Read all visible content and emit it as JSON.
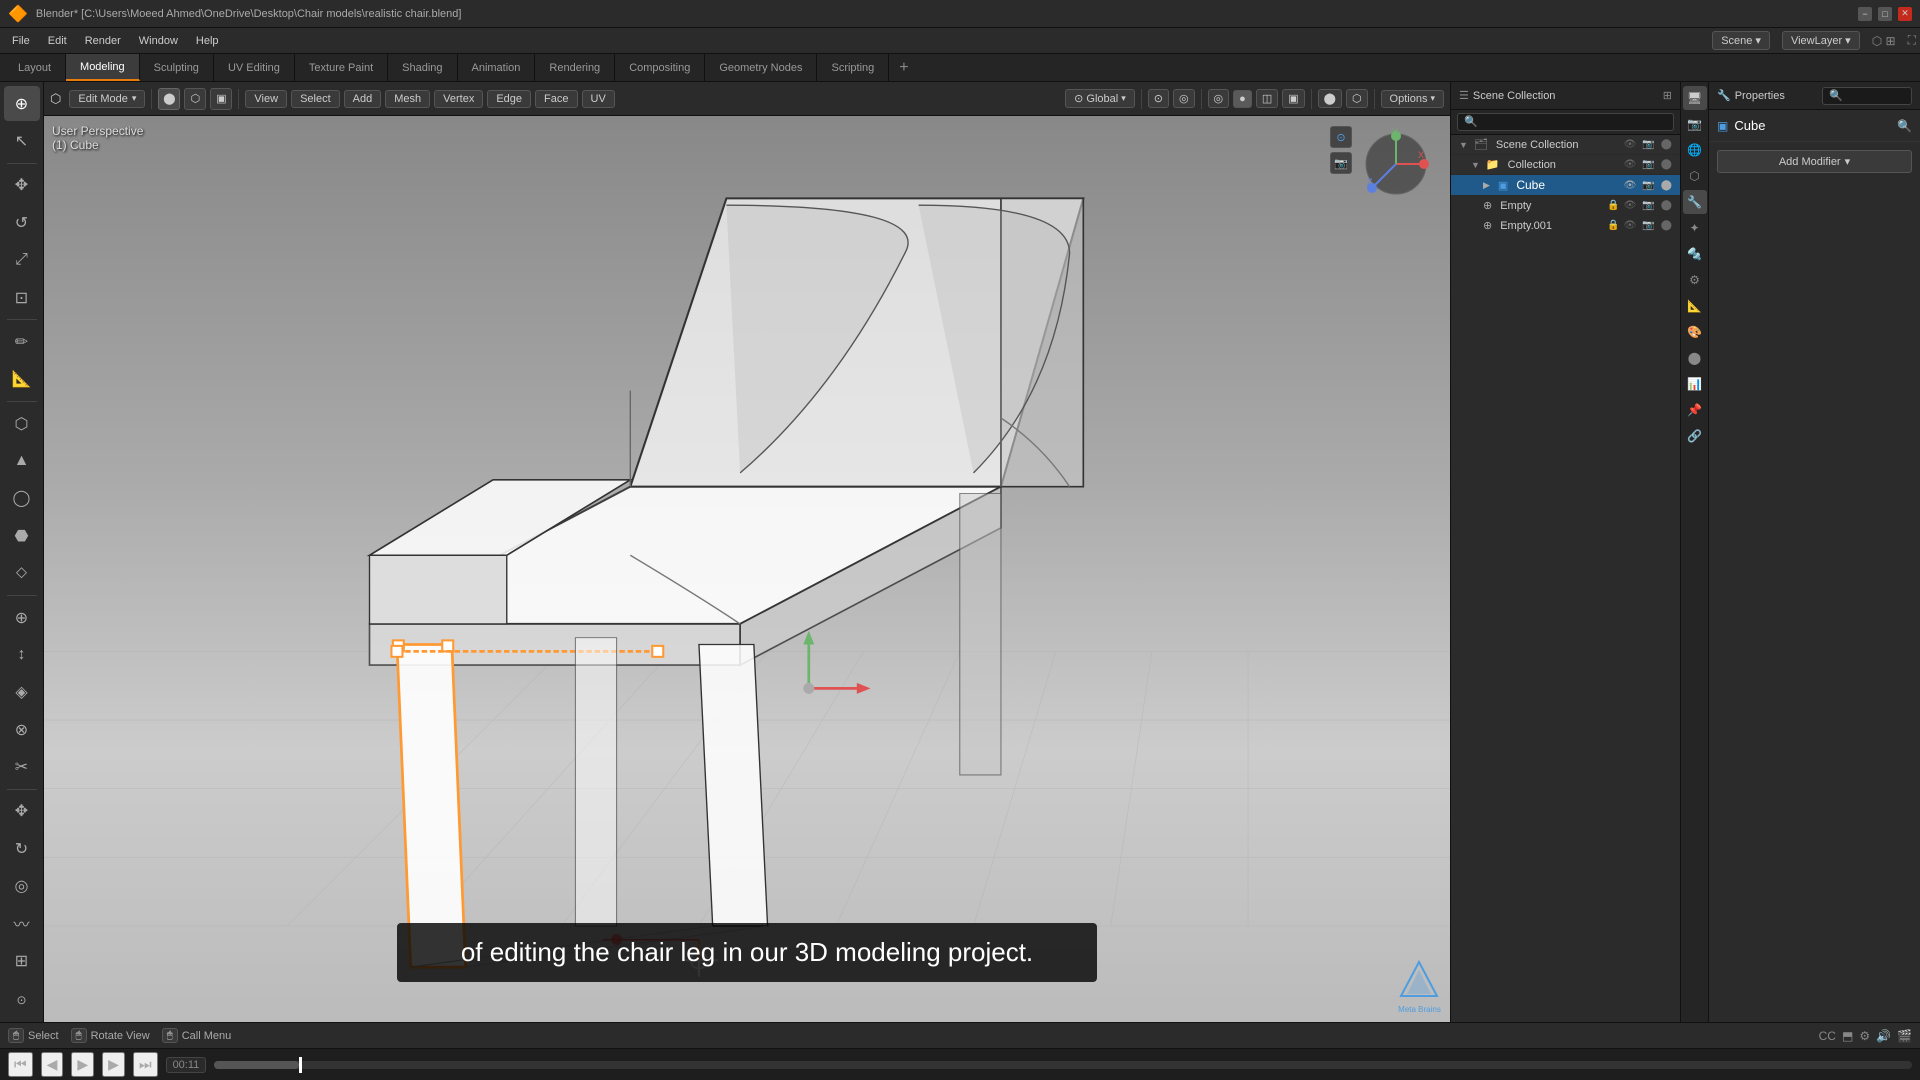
{
  "app": {
    "title": "Blender* [C:\\Users\\Moeed Ahmed\\OneDrive\\Desktop\\Chair models\\realistic chair.blend]",
    "logo": "🔶"
  },
  "titlebar": {
    "title": "Blender* [C:\\Users\\Moeed Ahmed\\OneDrive\\Desktop\\Chair models\\realistic chair.blend]",
    "minimize": "−",
    "maximize": "□",
    "close": "✕"
  },
  "menubar": {
    "items": [
      "File",
      "Edit",
      "Render",
      "Window",
      "Help"
    ]
  },
  "workspace_tabs": {
    "tabs": [
      "Layout",
      "Modeling",
      "Sculpting",
      "UV Editing",
      "Texture Paint",
      "Shading",
      "Animation",
      "Rendering",
      "Compositing",
      "Geometry Nodes",
      "Scripting"
    ],
    "active": "Modeling",
    "add_label": "+"
  },
  "viewport_header": {
    "editor_icon": "⬡",
    "mode": "Edit Mode",
    "view_label": "View",
    "select_label": "Select",
    "add_label": "Add",
    "mesh_label": "Mesh",
    "vertex_label": "Vertex",
    "edge_label": "Edge",
    "face_label": "Face",
    "uv_label": "UV",
    "pivot_label": "Global",
    "snapping_icon": "⊙",
    "proportional_icon": "◎",
    "overlay_icon": "⬤",
    "shading_icons": [
      "●",
      "○",
      "◫",
      "▣"
    ],
    "options_label": "Options"
  },
  "viewport": {
    "info_line1": "User Perspective",
    "info_line2": "(1) Cube"
  },
  "scene_outliner": {
    "title": "Scene Collection",
    "collection_label": "Collection",
    "items": [
      {
        "name": "Cube",
        "icon": "cube",
        "active": true
      },
      {
        "name": "Empty",
        "icon": "empty"
      },
      {
        "name": "Empty.001",
        "icon": "empty"
      }
    ]
  },
  "properties": {
    "object_name": "Cube",
    "search_placeholder": "🔍",
    "add_modifier_label": "Add Modifier",
    "icons": [
      "🔵",
      "🌐",
      "📐",
      "🔧",
      "✦",
      "🔩",
      "⚙",
      "🎨",
      "🖼",
      "📊",
      "📌",
      "🔗"
    ]
  },
  "subtitle": {
    "text": "of editing the chair leg in our 3D modeling project."
  },
  "bottom_bar": {
    "select_label": "Select",
    "select_icon": "🖱",
    "rotate_label": "Rotate View",
    "rotate_icon": "🖱",
    "call_menu_label": "Call Menu",
    "call_menu_icon": "🖱"
  },
  "timeline": {
    "play_icon": "▶",
    "prev_icon": "⏮",
    "next_icon": "⏭",
    "start_icon": "⏭",
    "time": "00:11",
    "progress_pct": 5
  },
  "status_bar": {
    "icons": [
      "CC",
      "⬒",
      "⚙",
      "🔊",
      "🎬"
    ]
  },
  "side_icons": {
    "view_icons": [
      "🖥",
      "✋",
      "📷",
      "📹",
      "📊"
    ],
    "prop_icons": [
      "🔵",
      "🌐",
      "📐",
      "🔧",
      "✦",
      "🔩",
      "⚙",
      "🎨",
      "🖼",
      "📊",
      "📌",
      "🔗",
      "🔲",
      "🔳"
    ]
  },
  "left_tools": {
    "tools": [
      {
        "icon": "↖",
        "name": "select"
      },
      {
        "icon": "✥",
        "name": "move"
      },
      {
        "icon": "↺",
        "name": "rotate"
      },
      {
        "icon": "⤢",
        "name": "scale"
      },
      {
        "icon": "⊡",
        "name": "transform"
      },
      {
        "icon": "⛯",
        "name": "annotate"
      },
      {
        "icon": "✏",
        "name": "draw"
      },
      {
        "icon": "⬜",
        "name": "box"
      },
      {
        "icon": "⬡",
        "name": "cube-add"
      },
      {
        "icon": "▲",
        "name": "cone-add"
      },
      {
        "icon": "◯",
        "name": "cylinder-add"
      },
      {
        "icon": "⬣",
        "name": "sphere-add"
      },
      {
        "icon": "⬦",
        "name": "monkey-add"
      },
      {
        "icon": "〰",
        "name": "curve"
      },
      {
        "icon": "⊞",
        "name": "grid"
      },
      {
        "icon": "✥",
        "name": "move2"
      },
      {
        "icon": "⊕",
        "name": "extrude"
      },
      {
        "icon": "↕",
        "name": "inset"
      },
      {
        "icon": "◈",
        "name": "bevel"
      },
      {
        "icon": "⊗",
        "name": "loop-cut"
      }
    ]
  }
}
